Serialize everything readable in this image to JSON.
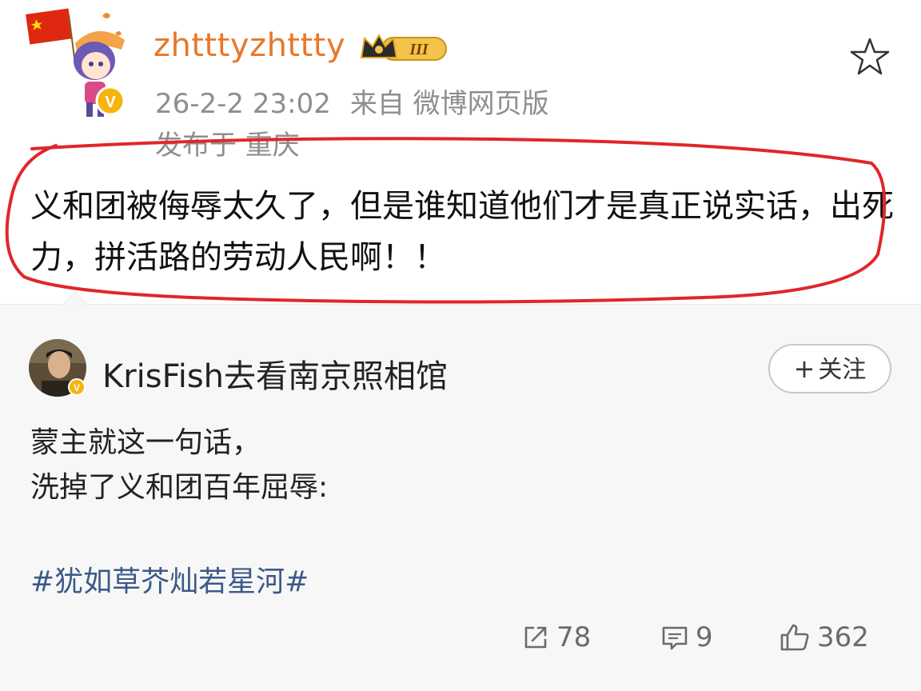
{
  "post": {
    "username": "zhtttyzhttty",
    "badge_text": "III",
    "date": "26-2-2 23:02",
    "source": "来自 微博网页版",
    "location": "发布于 重庆",
    "text": "义和团被侮辱太久了，但是谁知道他们才是真正说实话，出死力，拼活路的劳动人民啊！！",
    "accent_color": "#e8782a",
    "annotation_color": "#e0262b"
  },
  "repost": {
    "username": "KrisFish去看南京照相馆",
    "follow_plus": "+",
    "follow_label": "关注",
    "text_line1": "蒙主就这一句话，",
    "text_line2": "洗掉了义和团百年屈辱:",
    "hashtag": "#犹如草芥灿若星河#",
    "hashtag_color": "#3b5a88"
  },
  "actions": {
    "repost_icon": "share-icon",
    "repost_count": "78",
    "comment_icon": "comment-icon",
    "comment_count": "9",
    "like_icon": "thumbs-up-icon",
    "like_count": "362"
  }
}
